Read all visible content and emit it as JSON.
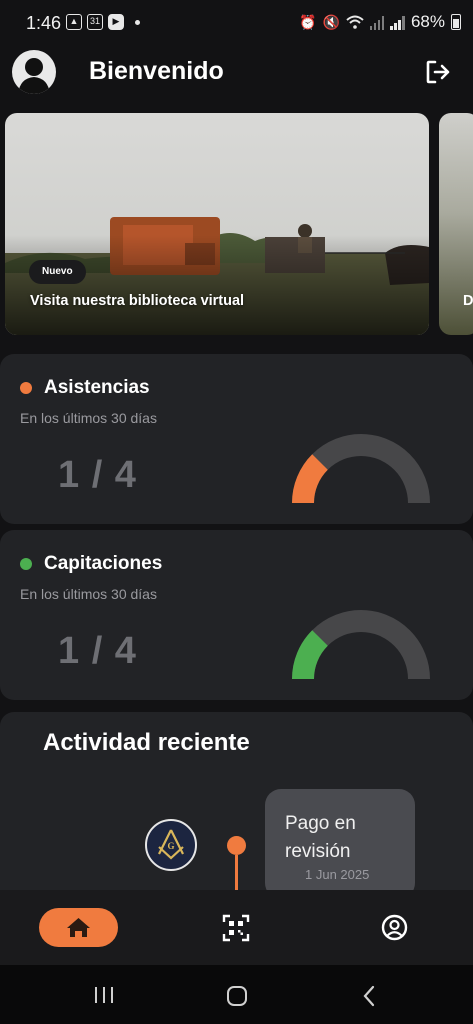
{
  "status_bar": {
    "time": "1:46",
    "calendar_day": "31",
    "battery": "68%"
  },
  "header": {
    "title": "Bienvenido"
  },
  "carousel": {
    "items": [
      {
        "badge": "Nuevo",
        "caption": "Visita nuestra biblioteca virtual"
      }
    ],
    "next_caption_peek": "D"
  },
  "cards": [
    {
      "title": "Asistencias",
      "subtitle": "En los últimos 30 días",
      "count": "1 / 4",
      "accent": "#f07b3f",
      "fraction": 0.25
    },
    {
      "title": "Capitaciones",
      "subtitle": "En los últimos 30 días",
      "count": "1 / 4",
      "accent": "#4caf50",
      "fraction": 0.25
    }
  ],
  "activity": {
    "title": "Actividad reciente",
    "items": [
      {
        "text": "Pago en revisión",
        "date": "1 Jun 2025",
        "accent": "#f07b3f"
      }
    ]
  },
  "bottom_nav": {
    "items": [
      {
        "icon": "home-icon",
        "active": true
      },
      {
        "icon": "qr-scan-icon",
        "active": false
      },
      {
        "icon": "profile-icon",
        "active": false
      }
    ]
  }
}
